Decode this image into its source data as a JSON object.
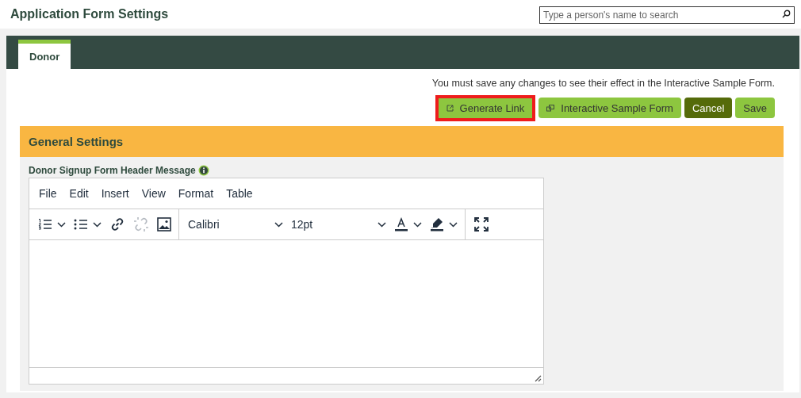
{
  "page_title": "Application Form Settings",
  "search": {
    "placeholder": "Type a person's name to search"
  },
  "tabs": [
    {
      "label": "Donor",
      "selected": true
    }
  ],
  "notice": "You must save any changes to see their effect in the Interactive Sample Form.",
  "buttons": [
    {
      "label": "Generate Link",
      "kind": "link",
      "highlighted": true
    },
    {
      "label": "Interactive Sample Form",
      "kind": "window",
      "highlighted": false
    },
    {
      "label": "Cancel",
      "kind": "dark",
      "highlighted": false
    },
    {
      "label": "Save",
      "kind": "plain",
      "highlighted": false
    }
  ],
  "section": {
    "title": "General Settings"
  },
  "field": {
    "label": "Donor Signup Form Header Message",
    "info": true
  },
  "editor": {
    "menu": [
      "File",
      "Edit",
      "Insert",
      "View",
      "Format",
      "Table"
    ],
    "toolbar": [
      [
        {
          "kind": "numbered-list",
          "disabled": false
        },
        {
          "kind": "bullet-list",
          "disabled": false
        },
        {
          "kind": "link",
          "disabled": false
        },
        {
          "kind": "unlink",
          "disabled": true
        },
        {
          "kind": "image",
          "disabled": false
        }
      ],
      [
        {
          "kind": "font",
          "value": "Calibri",
          "disabled": false
        },
        {
          "kind": "size",
          "value": "12pt",
          "disabled": false
        },
        {
          "kind": "text-color",
          "disabled": false
        },
        {
          "kind": "highlight",
          "disabled": false
        }
      ],
      [
        {
          "kind": "fullscreen",
          "disabled": false
        }
      ]
    ]
  }
}
